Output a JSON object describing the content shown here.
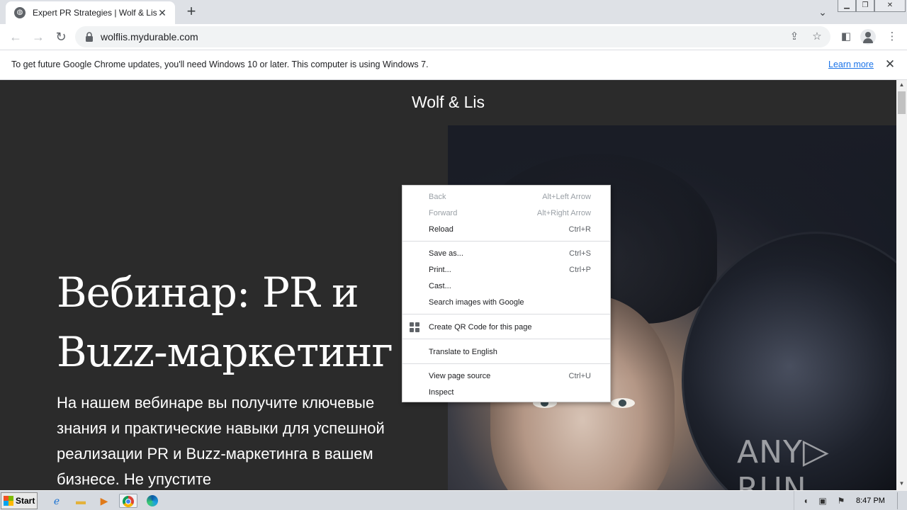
{
  "browser": {
    "tab": {
      "title": "Expert PR Strategies | Wolf & Lis",
      "favicon": "globe-icon",
      "close": "✕"
    },
    "new_tab": "+",
    "window_controls": [
      "minimize",
      "restore",
      "close"
    ],
    "toolbar": {
      "back": "back-arrow-icon",
      "forward": "forward-arrow-icon",
      "reload": "reload-icon",
      "url": "wolflis.mydurable.com"
    },
    "infobar": {
      "message": "To get future Google Chrome updates, you'll need Windows 10 or later. This computer is using Windows 7.",
      "link": "Learn more"
    }
  },
  "page": {
    "site_title": "Wolf & Lis",
    "heading": "Вебинар: PR и Buzz-маркетинг",
    "body_text": "На нашем вебинаре вы получите ключевые знания и практические навыки для успешной реализации PR и Buzz-маркетинга в вашем бизнесе. Не упустите"
  },
  "context_menu": {
    "groups": [
      [
        {
          "label": "Back",
          "shortcut": "Alt+Left Arrow",
          "disabled": true
        },
        {
          "label": "Forward",
          "shortcut": "Alt+Right Arrow",
          "disabled": true
        },
        {
          "label": "Reload",
          "shortcut": "Ctrl+R",
          "disabled": false
        }
      ],
      [
        {
          "label": "Save as...",
          "shortcut": "Ctrl+S",
          "disabled": false
        },
        {
          "label": "Print...",
          "shortcut": "Ctrl+P",
          "disabled": false
        },
        {
          "label": "Cast...",
          "shortcut": "",
          "disabled": false
        },
        {
          "label": "Search images with Google",
          "shortcut": "",
          "disabled": false
        }
      ],
      [
        {
          "label": "Create QR Code for this page",
          "shortcut": "",
          "disabled": false,
          "icon": "qr-code-icon"
        }
      ],
      [
        {
          "label": "Translate to English",
          "shortcut": "",
          "disabled": false
        }
      ],
      [
        {
          "label": "View page source",
          "shortcut": "Ctrl+U",
          "disabled": false
        },
        {
          "label": "Inspect",
          "shortcut": "",
          "disabled": false
        }
      ]
    ]
  },
  "watermark": {
    "left": "ANY",
    "right": "RUN"
  },
  "taskbar": {
    "start_label": "Start",
    "apps": [
      "internet-explorer-icon",
      "folder-icon",
      "media-player-icon",
      "chrome-icon",
      "edge-icon"
    ],
    "clock": "8:47 PM"
  },
  "colors": {
    "page_bg": "#2b2b2b",
    "link": "#1a73e8",
    "tab_strip": "#dee1e6"
  }
}
